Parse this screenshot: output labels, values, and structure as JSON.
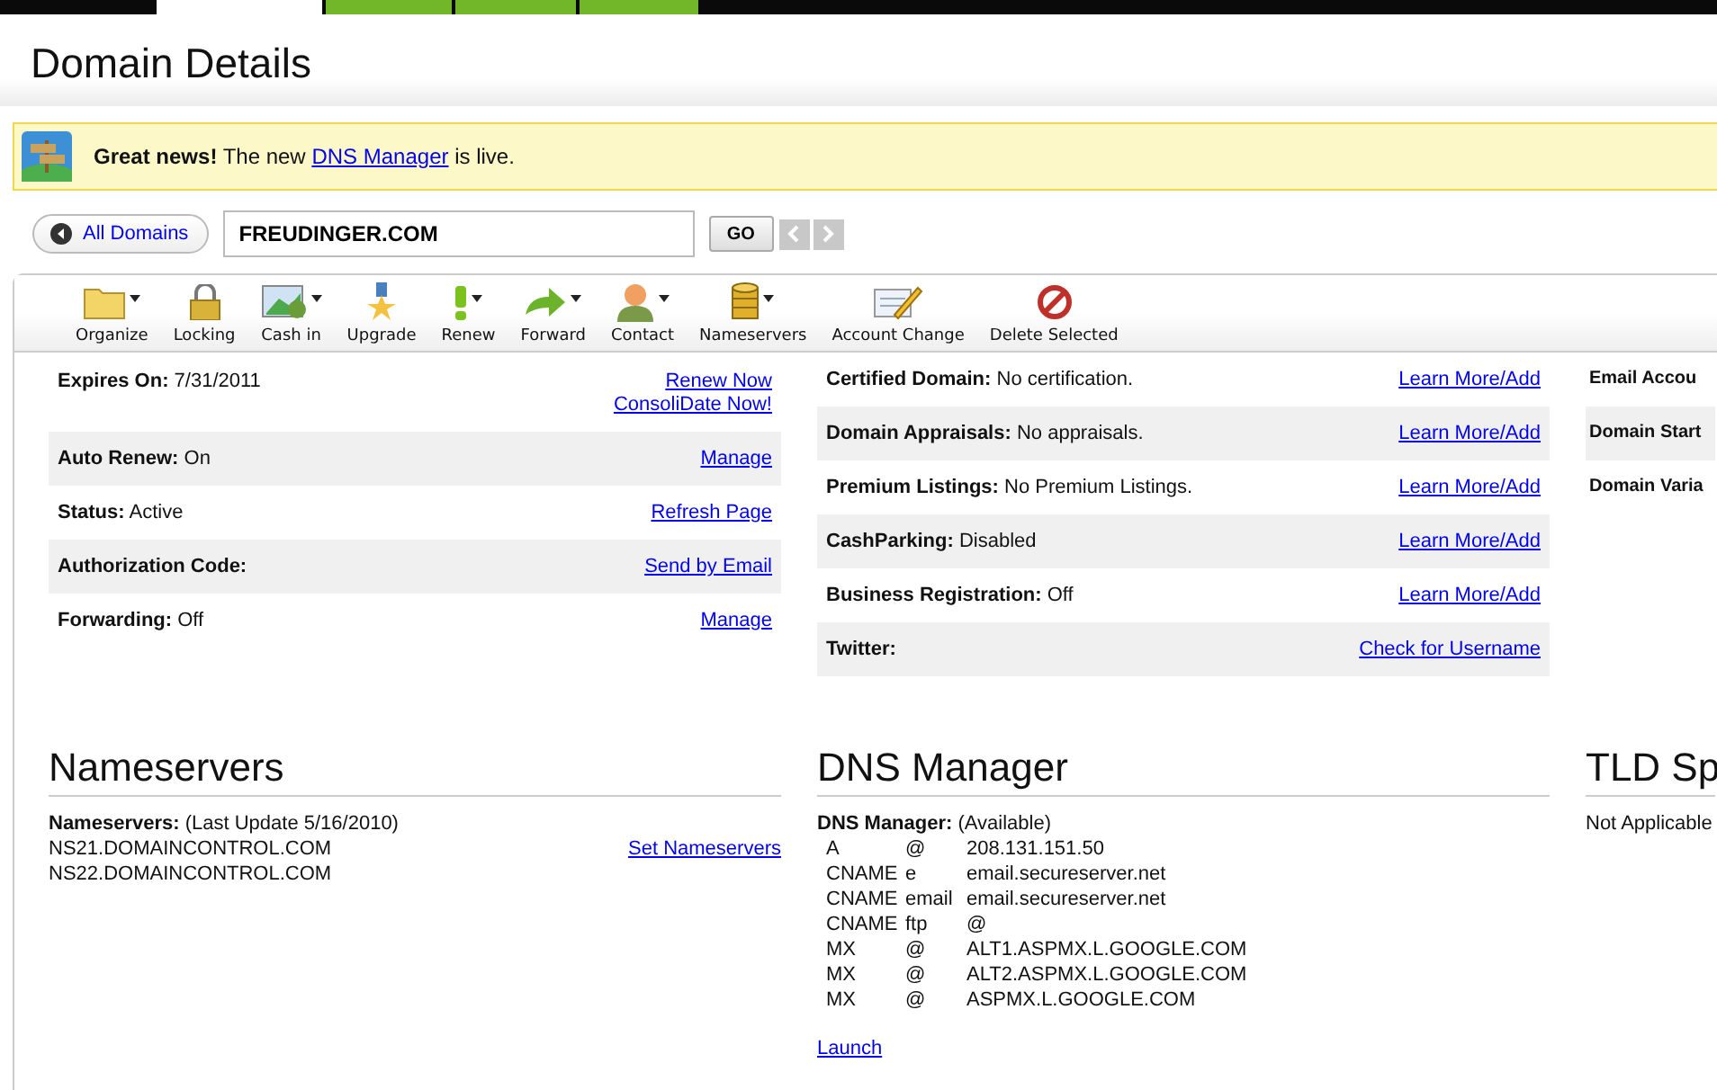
{
  "top_tabs": [
    {
      "selected": true
    },
    {
      "selected": false
    },
    {
      "selected": false
    },
    {
      "selected": false
    }
  ],
  "page_title": "Domain Details",
  "notice": {
    "before": "**Great news!** The new",
    "link": "DNS Manager",
    "after": "is live."
  },
  "search": {
    "back": "All Domains",
    "value": "FREUDINGER.COM",
    "go": "GO"
  },
  "toolbar": [
    {
      "label": "Organize",
      "kind": "folder",
      "menu": true
    },
    {
      "label": "Locking",
      "kind": "lock",
      "menu": false
    },
    {
      "label": "Cash in",
      "kind": "cash",
      "menu": true
    },
    {
      "label": "Upgrade",
      "kind": "medal",
      "menu": false
    },
    {
      "label": "Renew",
      "kind": "exclaim",
      "menu": true
    },
    {
      "label": "Forward",
      "kind": "arrow",
      "menu": true
    },
    {
      "label": "Contact",
      "kind": "person",
      "menu": true
    },
    {
      "label": "Nameservers",
      "kind": "database",
      "menu": true
    },
    {
      "label": "Account Change",
      "kind": "pencil",
      "menu": false
    },
    {
      "label": "Delete Selected",
      "kind": "prohibit",
      "menu": false
    }
  ],
  "details_left": [
    {
      "label": "Expires On:",
      "value": "7/31/2011",
      "links": [
        "Renew Now",
        "ConsoliDate Now!"
      ]
    },
    {
      "label": "Auto Renew:",
      "value": "On",
      "links": [
        "Manage"
      ]
    },
    {
      "label": "Status:",
      "value": "Active",
      "links": [
        "Refresh Page"
      ]
    },
    {
      "label": "Authorization Code:",
      "links": [
        "Send by Email"
      ]
    },
    {
      "label": "Forwarding:",
      "value": "Off",
      "links": [
        "Manage"
      ]
    }
  ],
  "details_middle": [
    {
      "label": "Certified Domain:",
      "value": "No certification.",
      "links": [
        "Learn More/Add"
      ]
    },
    {
      "label": "Domain Appraisals:",
      "value": "No appraisals.",
      "links": [
        "Learn More/Add"
      ]
    },
    {
      "label": "Premium Listings:",
      "value": "No Premium Listings.",
      "links": [
        "Learn More/Add"
      ]
    },
    {
      "label": "CashParking:",
      "value": "Disabled",
      "links": [
        "Learn More/Add"
      ]
    },
    {
      "label": "Business Registration:",
      "value": "Off",
      "links": [
        "Learn More/Add"
      ]
    },
    {
      "label": "Twitter:",
      "links": [
        "Check for Username"
      ]
    }
  ],
  "details_right": [
    {
      "label": "Email Accou"
    },
    {
      "label": "Domain Start"
    },
    {
      "label": "Domain Varia"
    }
  ],
  "nameservers": {
    "heading": "Nameservers",
    "label": "Nameservers:",
    "note": "(Last Update 5/16/2010)",
    "servers": [
      "NS21.DOMAINCONTROL.COM",
      "NS22.DOMAINCONTROL.COM"
    ],
    "link": "Set Nameservers"
  },
  "dns": {
    "heading": "DNS Manager",
    "label": "DNS Manager:",
    "note": "(Available)",
    "records": [
      {
        "type": "A",
        "host": "@",
        "value": "208.131.151.50"
      },
      {
        "type": "CNAME",
        "host": "e",
        "value": "email.secureserver.net"
      },
      {
        "type": "CNAME",
        "host": "email",
        "value": "email.secureserver.net"
      },
      {
        "type": "CNAME",
        "host": "ftp",
        "value": "@"
      },
      {
        "type": "MX",
        "host": "@",
        "value": "ALT1.ASPMX.L.GOOGLE.COM"
      },
      {
        "type": "MX",
        "host": "@",
        "value": "ALT2.ASPMX.L.GOOGLE.COM"
      },
      {
        "type": "MX",
        "host": "@",
        "value": "ASPMX.L.GOOGLE.COM"
      }
    ],
    "link": "Launch"
  },
  "tld": {
    "heading": "TLD Sp",
    "text": "Not Applicable"
  }
}
